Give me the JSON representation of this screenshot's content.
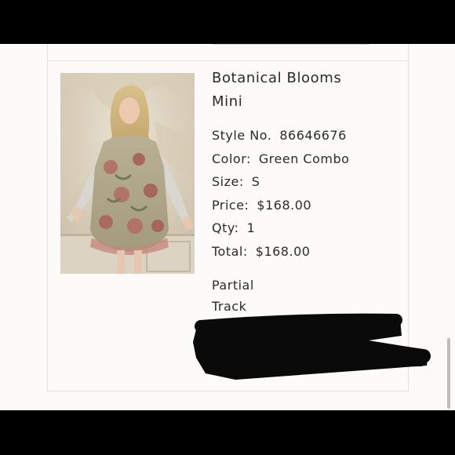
{
  "product": {
    "title": "Botanical Blooms Mini",
    "style_label": "Style No.",
    "style_value": "86646676",
    "color_label": "Color:",
    "color_value": "Green Combo",
    "size_label": "Size:",
    "size_value": "S",
    "price_label": "Price:",
    "price_value": "$168.00",
    "qty_label": "Qty:",
    "qty_value": "1",
    "total_label": "Total:",
    "total_value": "$168.00"
  },
  "shipment": {
    "status": "Partial",
    "tracking_partial": "Track"
  }
}
